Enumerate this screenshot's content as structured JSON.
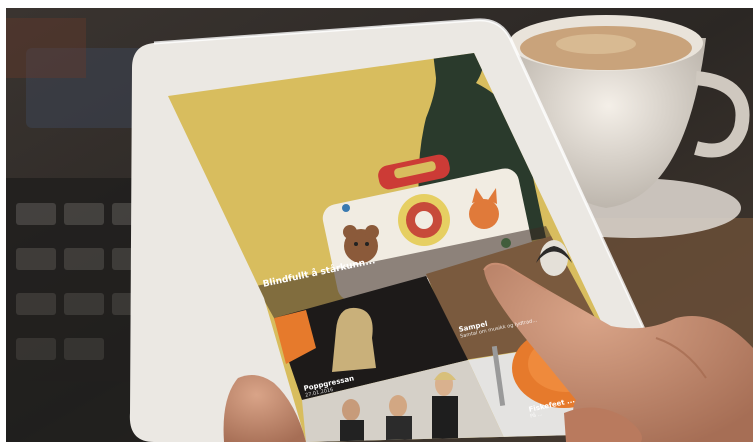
{
  "app": {
    "hero_title": "Blindfullt å stårkunn...",
    "tiles": [
      {
        "title": "Poppgressan",
        "subtitle": "27.01.2016"
      },
      {
        "title": "Sampel",
        "subtitle": "Samtal om musikk og lydtrad..."
      },
      {
        "title": "Fiskefeet ...",
        "subtitle": "På ..."
      }
    ]
  },
  "colors": {
    "hero_yellow": "#d8bd5e",
    "tablet_frame": "#ece9e4",
    "orange": "#e67a2c",
    "dark_tile": "#1d1a19",
    "brown_tile": "#7a5a3e"
  }
}
